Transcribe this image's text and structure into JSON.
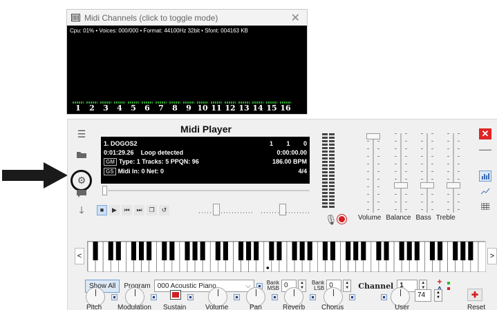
{
  "midi_channels": {
    "title": "Midi Channels (click to toggle mode)",
    "status": "Cpu: 01% • Voices: 000/000 • Format: 44100Hz 32bit • Sfont: 004163 KB",
    "channels": [
      "1",
      "2",
      "3",
      "4",
      "5",
      "6",
      "7",
      "8",
      "9",
      "10",
      "11",
      "12",
      "13",
      "14",
      "15",
      "16"
    ]
  },
  "player": {
    "title": "Midi Player",
    "track_name": "1. DOGOS2",
    "track_pos": "1",
    "track_pos2": "1",
    "track_pos3": "0",
    "elapsed": "0:01:29.26",
    "loop_status": "Loop detected",
    "loop_time": "0:00:00.00",
    "gm_badge": "GM",
    "type_info": "Type: 1  Tracks: 5  PPQN: 96",
    "bpm": "186.00 BPM",
    "gs_badge": "GS",
    "midi_in": "Midi In: 0  Net: 0",
    "time_sig": "4/4"
  },
  "mixer": {
    "labels": [
      "Volume",
      "Balance",
      "Bass",
      "Treble"
    ]
  },
  "program": {
    "show_all": "Show All",
    "label": "Program",
    "value": "000 Acoustic Piano",
    "bank_msb_label": "Bank MSB",
    "bank_msb": "0",
    "bank_lsb_label": "Bank LSB",
    "bank_lsb": "0",
    "channel_label": "Channel",
    "channel": "1"
  },
  "controls": {
    "labels": [
      "Pitch",
      "Modulation",
      "Sustain",
      "Volume",
      "Pan",
      "Reverb",
      "Chorus",
      "User",
      "Reset"
    ],
    "user_value": "74"
  },
  "colors": {
    "accent": "#e02424",
    "lcd": "#000000",
    "meter_green": "#2e9e2e"
  }
}
